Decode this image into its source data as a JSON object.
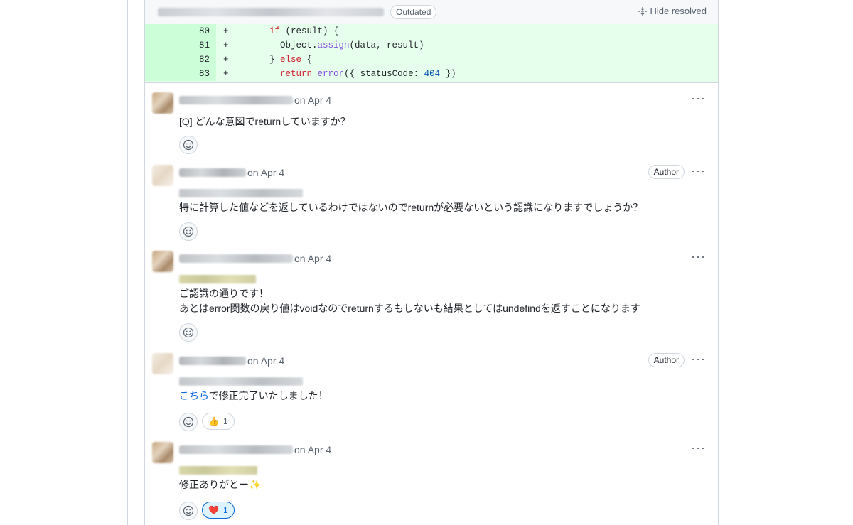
{
  "file_header": {
    "outdated_label": "Outdated",
    "hide_resolved_label": "Hide resolved"
  },
  "code_lines": [
    {
      "num": "80",
      "sign": "+"
    },
    {
      "num": "81",
      "sign": "+"
    },
    {
      "num": "82",
      "sign": "+"
    },
    {
      "num": "83",
      "sign": "+"
    }
  ],
  "code_tokens": {
    "l80": {
      "kw_if": "if",
      "rest": " (result) {"
    },
    "l81": {
      "obj": "Object.",
      "fn": "assign",
      "rest": "(data, result)"
    },
    "l82": {
      "pre": "} ",
      "kw_else": "else",
      "post": " {"
    },
    "l83": {
      "kw_return": "return",
      "fn": "error",
      "mid": "({ statusCode: ",
      "num": "404",
      "end": " })"
    }
  },
  "comments": [
    {
      "date": "on Apr 4",
      "text": "[Q] どんな意図でreturnしていますか？"
    },
    {
      "date": "on Apr 4",
      "badge": "Author",
      "text": "特に計算した値などを返しているわけではないのでreturnが必要ないという認識になりますでしょうか？"
    },
    {
      "date": "on Apr 4",
      "text_line1": "ご認識の通りです！",
      "text_line2": "あとはerror関数の戻り値はvoidなのでreturnするもしないも結果としてはundefindを返すことになります"
    },
    {
      "date": "on Apr 4",
      "badge": "Author",
      "link_text": "こちら",
      "text_rest": "で修正完了いたしました！",
      "reaction_emoji": "👍",
      "reaction_count": "1"
    },
    {
      "date": "on Apr 4",
      "text": "修正ありがとー✨",
      "reaction_emoji": "❤️",
      "reaction_count": "1"
    }
  ],
  "more_label": "···",
  "colors": {
    "added_bg": "#e6ffec",
    "line_num_bg": "#ccffd8",
    "link": "#0969da"
  },
  "icons": [
    "unfold-icon",
    "kebab-menu-icon",
    "smiley-icon"
  ]
}
